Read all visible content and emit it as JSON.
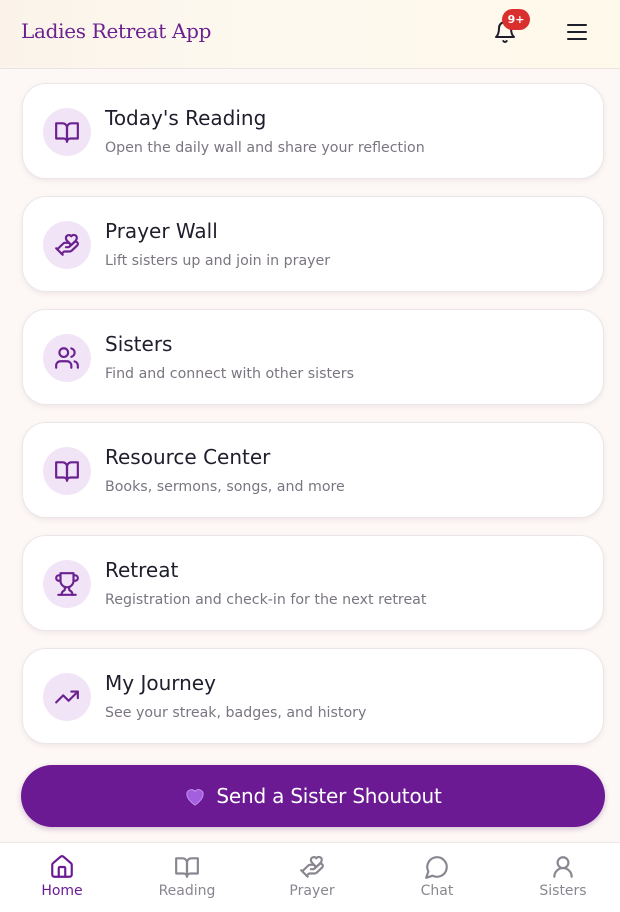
{
  "header": {
    "app_title": "Ladies Retreat App",
    "notification_count": "9+",
    "bell_icon": "bell-icon",
    "menu_icon": "hamburger-menu-icon"
  },
  "cards": [
    {
      "icon": "book-open-icon",
      "title": "Today's Reading",
      "subtitle": "Open the daily wall and share your reflection"
    },
    {
      "icon": "hand-heart-icon",
      "title": "Prayer Wall",
      "subtitle": "Lift sisters up and join in prayer"
    },
    {
      "icon": "users-icon",
      "title": "Sisters",
      "subtitle": "Find and connect with other sisters"
    },
    {
      "icon": "book-open-icon",
      "title": "Resource Center",
      "subtitle": "Books, sermons, songs, and more"
    },
    {
      "icon": "trophy-icon",
      "title": "Retreat",
      "subtitle": "Registration and check-in for the next retreat"
    },
    {
      "icon": "trending-up-icon",
      "title": "My Journey",
      "subtitle": "See your streak, badges, and history"
    }
  ],
  "shoutout": {
    "icon": "purple-heart-icon",
    "label": "Send a Sister Shoutout"
  },
  "bottom_nav": [
    {
      "icon": "home-icon",
      "label": "Home",
      "active": true
    },
    {
      "icon": "book-open-icon",
      "label": "Reading",
      "active": false
    },
    {
      "icon": "hand-heart-icon",
      "label": "Prayer",
      "active": false
    },
    {
      "icon": "chat-bubble-icon",
      "label": "Chat",
      "active": false
    },
    {
      "icon": "user-icon",
      "label": "Sisters",
      "active": false
    }
  ],
  "colors": {
    "brand_purple": "#6c1a94",
    "icon_purple": "#6b2290",
    "icon_bg": "#f1e4f6",
    "badge_red": "#d92f2f",
    "nav_inactive": "#8a8690"
  }
}
